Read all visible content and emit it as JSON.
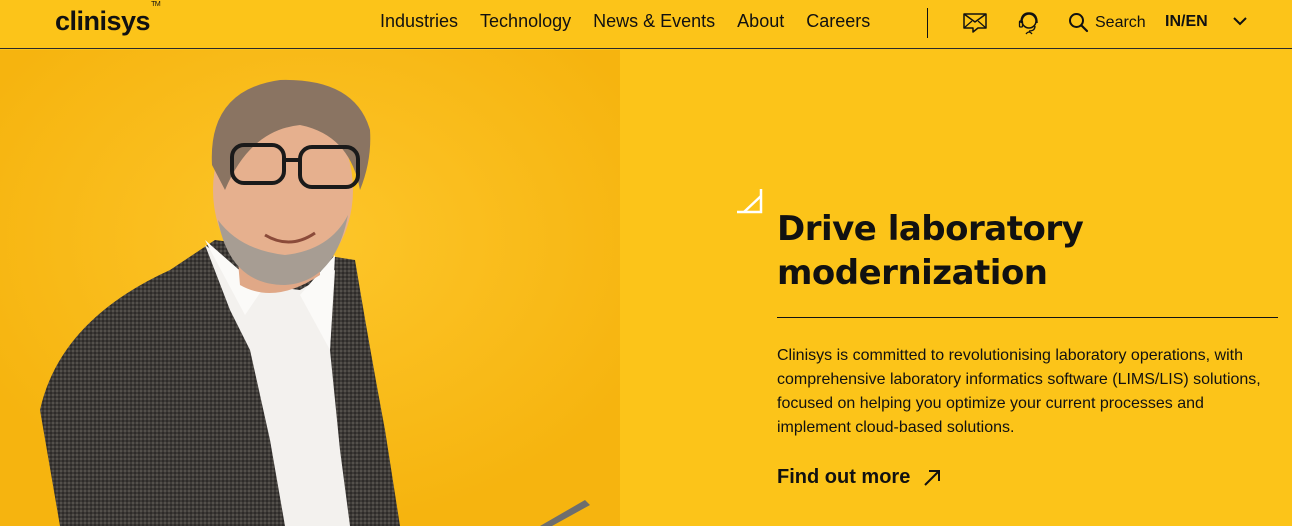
{
  "header": {
    "logo_text": "clinisys",
    "logo_tm": "TM",
    "nav": [
      "Industries",
      "Technology",
      "News & Events",
      "About",
      "Careers"
    ],
    "search_label": "Search",
    "language": "IN/EN"
  },
  "hero": {
    "headline_line1": "Drive laboratory",
    "headline_line2": "modernization",
    "body": "Clinisys is committed to revolutionising laboratory operations, with comprehensive laboratory informatics software (LIMS/LIS) solutions, focused on helping you optimize your current processes and implement cloud-based solutions.",
    "cta_label": "Find out more"
  },
  "colors": {
    "brand_yellow": "#fcc419",
    "text_dark": "#111111"
  },
  "icons": [
    "mail-icon",
    "support-headset-icon",
    "search-icon",
    "chevron-down-icon",
    "arrow-up-right-icon",
    "corner-accent-icon"
  ]
}
